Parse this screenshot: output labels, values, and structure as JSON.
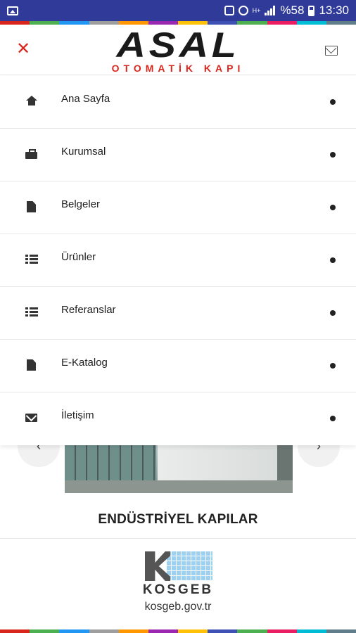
{
  "status_bar": {
    "battery_text": "%58",
    "time": "13:30",
    "network_label": "H+",
    "icons": [
      "image-icon",
      "nfc-icon",
      "alarm-icon",
      "signal-icon",
      "battery-icon"
    ]
  },
  "stripe_colors": [
    "#d9261c",
    "#4caf50",
    "#2196f3",
    "#9e9e9e",
    "#ff9800",
    "#9c27b0",
    "#ffc107",
    "#3f51b5",
    "#4caf50",
    "#e91e63",
    "#00bcd4",
    "#607d8b"
  ],
  "header": {
    "close_icon": "close-icon",
    "logo_main": "ASAL",
    "logo_sub": "OTOMATİK KAPI",
    "mail_icon": "mail-icon"
  },
  "menu": {
    "items": [
      {
        "label": "Ana Sayfa",
        "icon": "home-icon"
      },
      {
        "label": "Kurumsal",
        "icon": "briefcase-icon"
      },
      {
        "label": "Belgeler",
        "icon": "file-icon"
      },
      {
        "label": "Ürünler",
        "icon": "list-icon"
      },
      {
        "label": "Referanslar",
        "icon": "list-icon"
      },
      {
        "label": "E-Katalog",
        "icon": "file-icon"
      },
      {
        "label": "İletişim",
        "icon": "envelope-icon"
      }
    ]
  },
  "slider": {
    "prev_label": "‹",
    "next_label": "›",
    "title": "ENDÜSTRİYEL KAPILAR"
  },
  "footer": {
    "brand": "KOSGEB",
    "url": "kosgeb.gov.tr"
  },
  "colors": {
    "status_bar_bg": "#2f3a99",
    "accent_red": "#d9261c"
  }
}
